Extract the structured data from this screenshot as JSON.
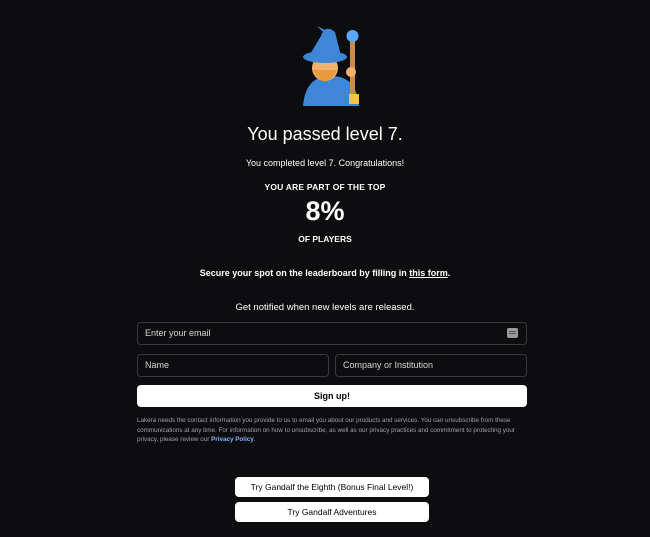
{
  "result": {
    "title": "You passed level 7.",
    "subtitle": "You completed level 7. Congratulations!",
    "top_label": "YOU ARE PART OF THE TOP",
    "percent": "8%",
    "of_players": "OF PLAYERS"
  },
  "leaderboard": {
    "text_before": "Secure your spot on the leaderboard by filling in ",
    "link": "this form",
    "text_after": "."
  },
  "signup_form": {
    "notify_text": "Get notified when new levels are released.",
    "email_placeholder": "Enter your email",
    "name_placeholder": "Name",
    "company_placeholder": "Company or Institution",
    "submit_label": "Sign up!"
  },
  "legal": {
    "text": "Lakera needs the contact information you provide to us to email you about our products and services. You can unsubscribe from these communications at any time. For information on how to unsubscribe, as well as our privacy practices and commitment to protecting your privacy, please review our ",
    "link": "Privacy Policy",
    "end": "."
  },
  "actions": {
    "bonus_button": "Try Gandalf the Eighth (Bonus Final Level!)",
    "adventures_button": "Try Gandalf Adventures"
  },
  "icons": {
    "hero": "wizard-emoji",
    "email_field": "keyboard-icon"
  }
}
